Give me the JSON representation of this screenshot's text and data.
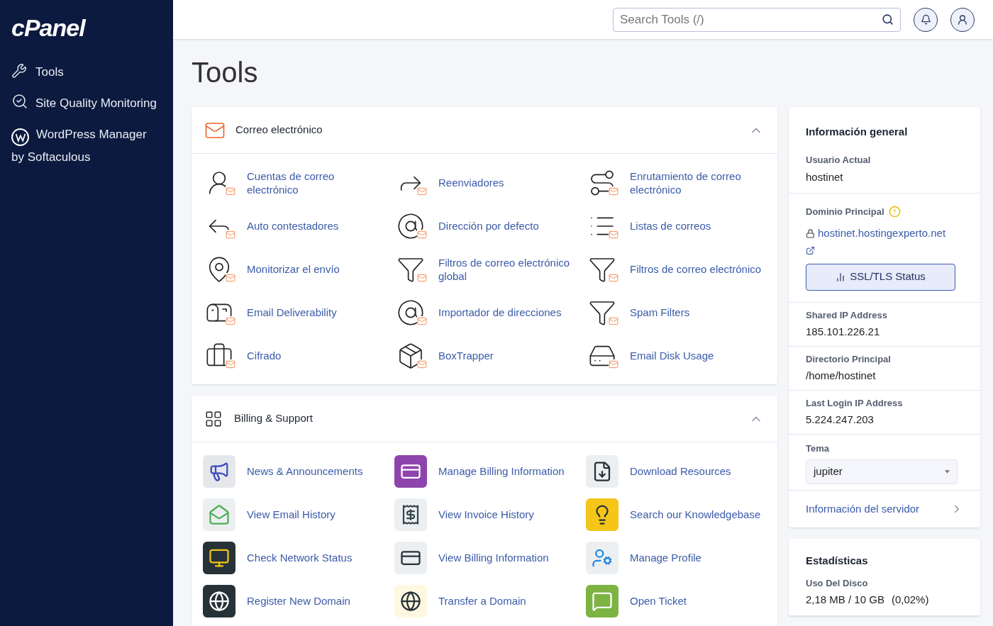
{
  "sidebar": {
    "logo": "cPanel",
    "items": [
      {
        "label": "Tools"
      },
      {
        "label": "Site Quality Monitoring"
      },
      {
        "label": "WordPress Manager by Softaculous"
      }
    ]
  },
  "topbar": {
    "search": {
      "placeholder": "Search Tools (/)"
    }
  },
  "page": {
    "title": "Tools"
  },
  "sections": [
    {
      "title": "Correo electrónico",
      "expanded": true,
      "tools": [
        {
          "label": "Cuentas de correo electrónico"
        },
        {
          "label": "Reenviadores"
        },
        {
          "label": "Enrutamiento de correo electrónico"
        },
        {
          "label": "Auto contestadores"
        },
        {
          "label": "Dirección por defecto"
        },
        {
          "label": "Listas de correos"
        },
        {
          "label": "Monitorizar el envío"
        },
        {
          "label": "Filtros de correo electrónico global"
        },
        {
          "label": "Filtros de correo electrónico"
        },
        {
          "label": "Email Deliverability"
        },
        {
          "label": "Importador de direcciones"
        },
        {
          "label": "Spam Filters"
        },
        {
          "label": "Cifrado"
        },
        {
          "label": "BoxTrapper"
        },
        {
          "label": "Email Disk Usage"
        }
      ]
    },
    {
      "title": "Billing & Support",
      "expanded": true,
      "tools": [
        {
          "label": "News & Announcements"
        },
        {
          "label": "Manage Billing Information"
        },
        {
          "label": "Download Resources"
        },
        {
          "label": "View Email History"
        },
        {
          "label": "View Invoice History"
        },
        {
          "label": "Search our Knowledgebase"
        },
        {
          "label": "Check Network Status"
        },
        {
          "label": "View Billing Information"
        },
        {
          "label": "Manage Profile"
        },
        {
          "label": "Register New Domain"
        },
        {
          "label": "Transfer a Domain"
        },
        {
          "label": "Open Ticket"
        }
      ]
    }
  ],
  "general_info": {
    "title": "Información general",
    "current_user": {
      "label": "Usuario Actual",
      "value": "hostinet"
    },
    "primary_domain": {
      "label": "Dominio Principal",
      "value": "hostinet.hostingexperto.net",
      "button": "SSL/TLS Status"
    },
    "fields": [
      {
        "label": "Shared IP Address",
        "value": "185.101.226.21"
      },
      {
        "label": "Directorio Principal",
        "value": "/home/hostinet"
      },
      {
        "label": "Last Login IP Address",
        "value": "5.224.247.203"
      }
    ],
    "theme": {
      "label": "Tema",
      "value": "jupiter"
    },
    "server_info_link": "Información del servidor"
  },
  "statistics": {
    "title": "Estadísticas",
    "items": [
      {
        "label": "Uso Del Disco",
        "value": "2,18 MB / 10 GB",
        "percent": "(0,02%)"
      }
    ]
  }
}
